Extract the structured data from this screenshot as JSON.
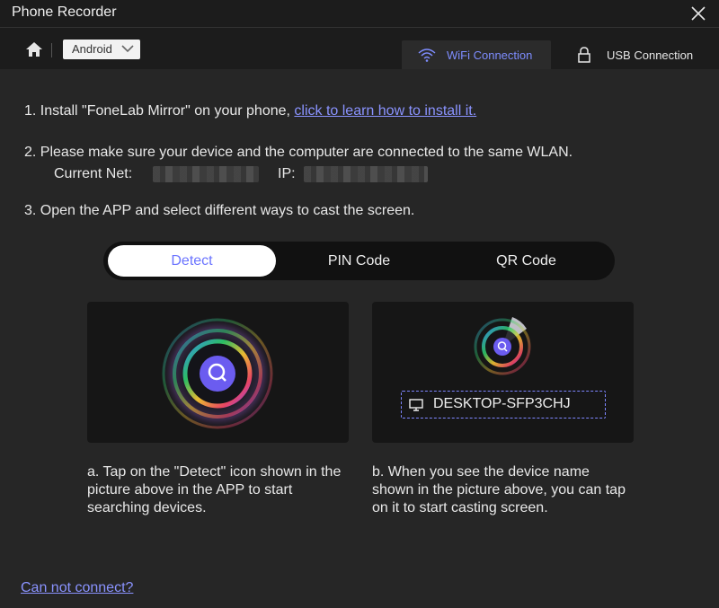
{
  "window": {
    "title": "Phone Recorder"
  },
  "topbar": {
    "platform": "Android",
    "tabs": [
      {
        "label": "WiFi Connection",
        "icon": "wifi-icon",
        "active": true
      },
      {
        "label": "USB Connection",
        "icon": "usb-lock-icon",
        "active": false
      }
    ]
  },
  "steps": {
    "step1_text": "1. Install \"FoneLab Mirror\" on your phone, ",
    "step1_link": "click to learn how to install it.",
    "step2_text": "2. Please make sure your device and the computer are connected to the same WLAN.",
    "current_net_label": "Current Net:",
    "ip_label": "IP:",
    "step3_text": "3. Open the APP and select different ways to cast the screen."
  },
  "modes": [
    "Detect",
    "PIN Code",
    "QR Code"
  ],
  "device": {
    "name": "DESKTOP-SFP3CHJ"
  },
  "descriptions": {
    "a": "a. Tap on the \"Detect\" icon shown in the picture above in the APP to start searching devices.",
    "b": "b. When you see the device name shown in the picture above, you can tap on it to start casting screen."
  },
  "help_link": "Can not connect?",
  "colors": {
    "accent": "#7e8dff",
    "background": "#262626",
    "bar": "#1c1c1c"
  }
}
